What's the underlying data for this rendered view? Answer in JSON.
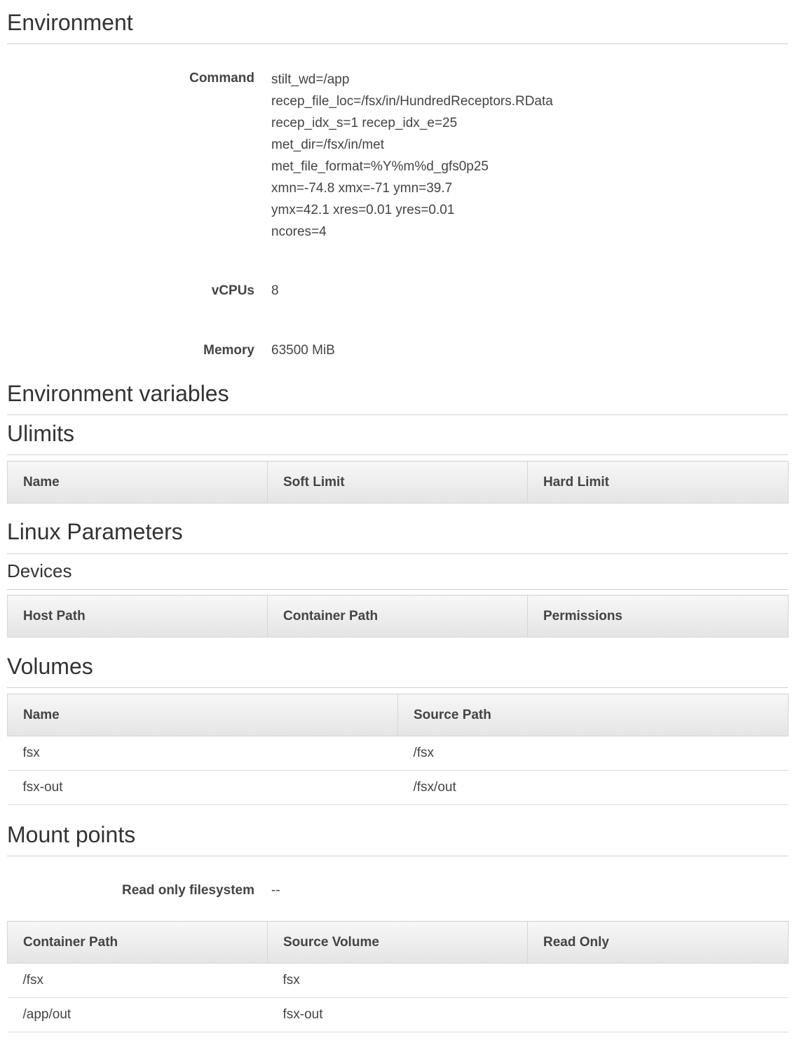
{
  "environment": {
    "title": "Environment",
    "command_label": "Command",
    "command_lines": [
      "stilt_wd=/app",
      "recep_file_loc=/fsx/in/HundredReceptors.RData",
      "recep_idx_s=1 recep_idx_e=25",
      "met_dir=/fsx/in/met",
      "met_file_format=%Y%m%d_gfs0p25",
      "xmn=-74.8 xmx=-71 ymn=39.7",
      "ymx=42.1 xres=0.01 yres=0.01",
      "ncores=4"
    ],
    "vcpus_label": "vCPUs",
    "vcpus_value": "8",
    "memory_label": "Memory",
    "memory_value": "63500 MiB"
  },
  "env_vars": {
    "title": "Environment variables"
  },
  "ulimits": {
    "title": "Ulimits",
    "columns": [
      "Name",
      "Soft Limit",
      "Hard Limit"
    ]
  },
  "linux": {
    "title": "Linux Parameters",
    "devices_title": "Devices",
    "device_columns": [
      "Host Path",
      "Container Path",
      "Permissions"
    ]
  },
  "volumes": {
    "title": "Volumes",
    "columns": [
      "Name",
      "Source Path"
    ],
    "rows": [
      [
        "fsx",
        "/fsx"
      ],
      [
        "fsx-out",
        "/fsx/out"
      ]
    ]
  },
  "mounts": {
    "title": "Mount points",
    "readonly_label": "Read only filesystem",
    "readonly_value": "--",
    "columns": [
      "Container Path",
      "Source Volume",
      "Read Only"
    ],
    "rows": [
      [
        "/fsx",
        "fsx",
        ""
      ],
      [
        "/app/out",
        "fsx-out",
        ""
      ]
    ]
  }
}
